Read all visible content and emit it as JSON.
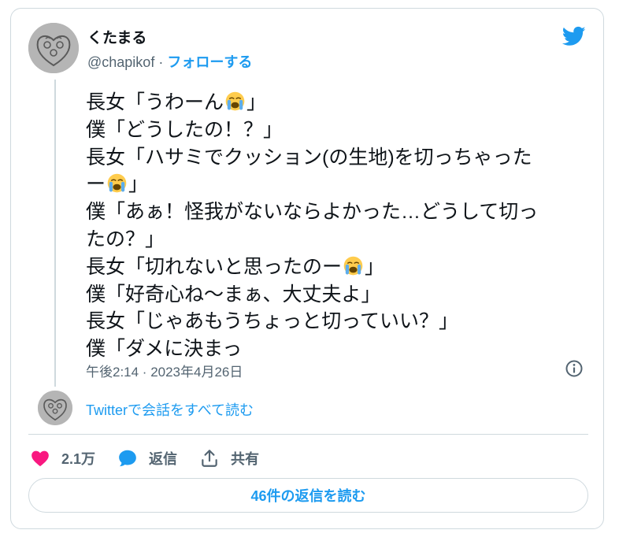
{
  "author": {
    "display_name": "くたまる",
    "handle": "@chapikof",
    "separator": " · ",
    "follow_label": "フォローする"
  },
  "tweet": {
    "lines": [
      {
        "before": "長女「うわーん",
        "emoji": "loudly-crying-face",
        "after": "」"
      },
      {
        "before": "僕「どうしたの！？」"
      },
      {
        "before": "長女「ハサミでクッション(の生地)を切っちゃった"
      },
      {
        "before": "ー",
        "emoji": "loudly-crying-face",
        "after": "」"
      },
      {
        "before": "僕「あぁ！怪我がないならよかった…どうして切っ"
      },
      {
        "before": "たの？」"
      },
      {
        "before": "長女「切れないと思ったのー",
        "emoji": "loudly-crying-face",
        "after": "」"
      },
      {
        "before": "僕「好奇心ね〜まぁ、大丈夫よ」"
      },
      {
        "before": "長女「じゃあもうちょっと切っていい？」"
      },
      {
        "before": "僕「ダメに決まっ"
      }
    ],
    "timestamp": "午後2:14 · 2023年4月26日"
  },
  "conversation": {
    "read_label": "Twitterで会話をすべて読む"
  },
  "actions": {
    "like_count": "2.1万",
    "reply_label": "返信",
    "share_label": "共有"
  },
  "replies_button_label": "46件の返信を読む",
  "icons": {
    "brand": "twitter-bird-icon",
    "info": "info-icon",
    "like": "heart-icon",
    "reply": "speech-bubble-icon",
    "share": "share-icon"
  },
  "colors": {
    "accent": "#1d9bf0",
    "like": "#f91880",
    "text": "#0f1419",
    "secondary": "#536471",
    "border": "#cfd9de"
  }
}
